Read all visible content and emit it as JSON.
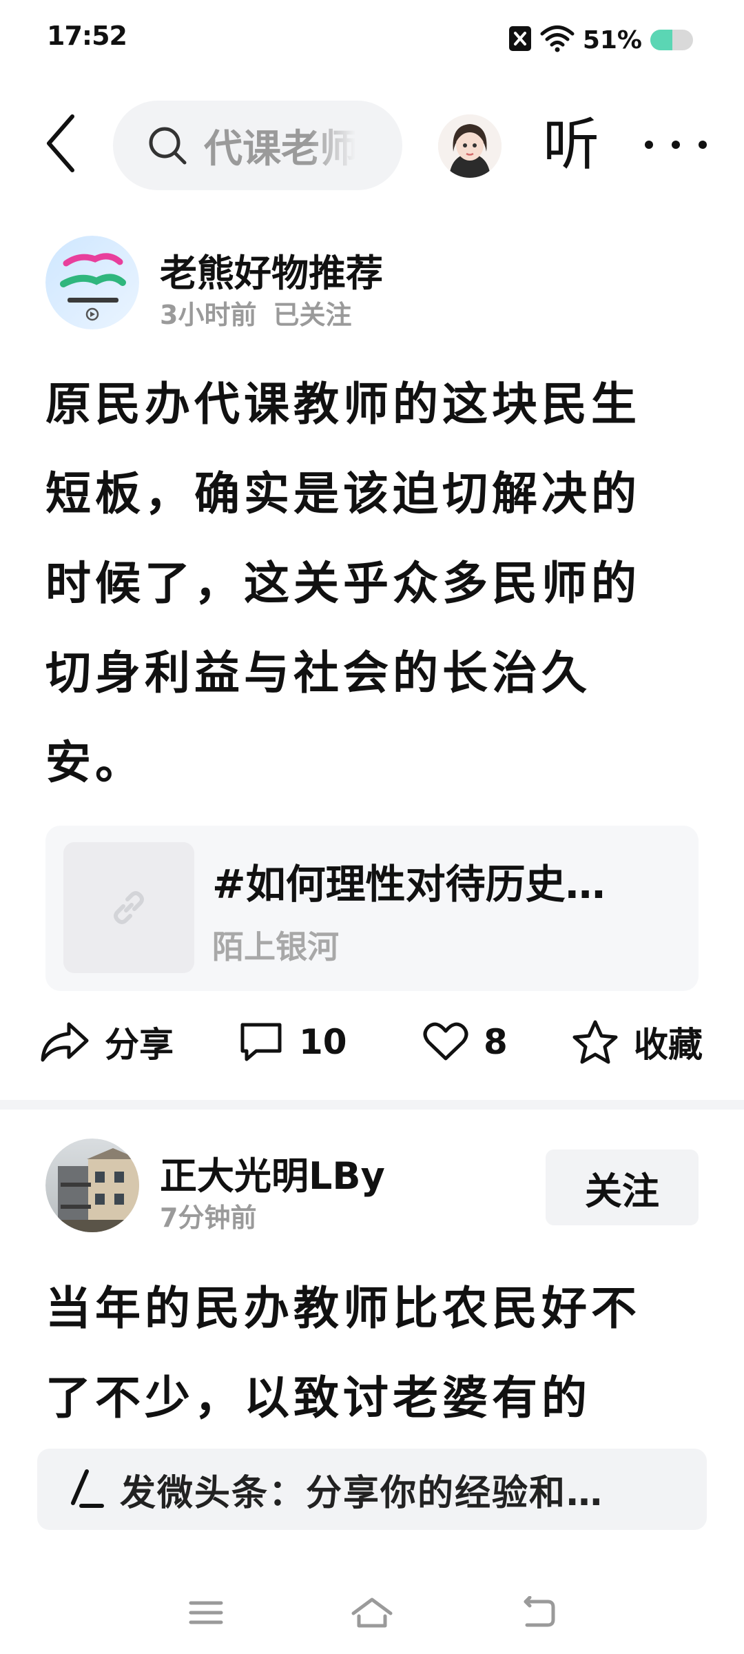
{
  "status_bar": {
    "time": "17:52",
    "battery_text": "51%",
    "battery_level": 0.51,
    "battery_color": "#5bd6b4",
    "icons": [
      "sim-off-icon",
      "wifi-icon",
      "battery-icon"
    ]
  },
  "top_nav": {
    "search_text": "代课老师",
    "listen_label": "听",
    "icons": [
      "back-arrow-icon",
      "search-icon",
      "more-icon"
    ]
  },
  "post1": {
    "author_name": "老熊好物推荐",
    "time": "3小时前",
    "follow_status": "已关注",
    "lines": [
      "原民办代课教师的这块民生",
      "短板，确实是该迫切解决的",
      "时候了，这关乎众多民师的",
      "切身利益与社会的长治久",
      "安。"
    ],
    "link_card": {
      "title": "#如何理性对待历史…",
      "subtitle": "陌上银河",
      "icon": "link-icon"
    },
    "actions": {
      "share_label": "分享",
      "comment_count": "10",
      "like_count": "8",
      "favorite_label": "收藏"
    }
  },
  "post2": {
    "author_name": "正大光明LBy",
    "time": "7分钟前",
    "follow_label": "关注",
    "lines": [
      "当年的民办教师比农民好不",
      "了不少，以致讨老婆有的"
    ]
  },
  "composer": {
    "placeholder": "发微头条：分享你的经验和…",
    "icon": "pen-icon"
  },
  "system_nav": {
    "icons": [
      "menu-icon",
      "home-icon",
      "back-icon"
    ]
  }
}
